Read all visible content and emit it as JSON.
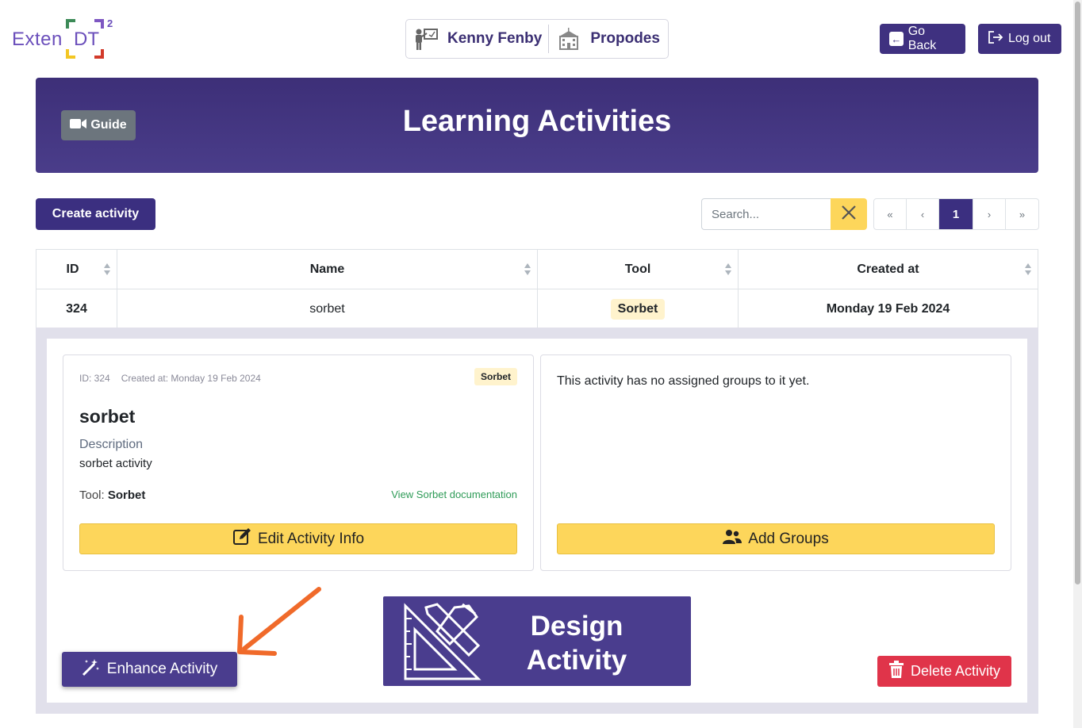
{
  "logo": {
    "text": "Exten",
    "mark": "DT",
    "sup": "2"
  },
  "user": {
    "teacher_icon": "teacher-icon",
    "name": "Kenny Fenby",
    "school_icon": "school-icon",
    "school": "Propodes"
  },
  "nav": {
    "go_back": "Go Back",
    "log_out": "Log out"
  },
  "banner": {
    "title": "Learning Activities",
    "guide": "Guide"
  },
  "toolbar": {
    "create": "Create activity",
    "search_placeholder": "Search...",
    "pager": {
      "first": "«",
      "prev": "‹",
      "current": "1",
      "next": "›",
      "last": "»"
    }
  },
  "table": {
    "headers": [
      "ID",
      "Name",
      "Tool",
      "Created at"
    ],
    "rows": [
      {
        "id": "324",
        "name": "sorbet",
        "tool": "Sorbet",
        "created": "Monday 19 Feb 2024"
      }
    ]
  },
  "detail": {
    "meta_id": "ID: 324",
    "meta_created": "Created at: Monday 19 Feb 2024",
    "badge": "Sorbet",
    "name": "sorbet",
    "description_label": "Description",
    "description": "sorbet activity",
    "tool_label": "Tool:",
    "tool_value": "Sorbet",
    "doc_link": "View Sorbet documentation",
    "edit_button": "Edit Activity Info",
    "no_groups": "This activity has no assigned groups to it yet.",
    "add_groups": "Add Groups",
    "design_line1": "Design",
    "design_line2": "Activity",
    "enhance": "Enhance Activity",
    "delete": "Delete Activity"
  },
  "colors": {
    "primary": "#3f3180",
    "accent_yellow": "#fdd65b",
    "danger": "#e0344a",
    "arrow": "#f06a2a"
  }
}
